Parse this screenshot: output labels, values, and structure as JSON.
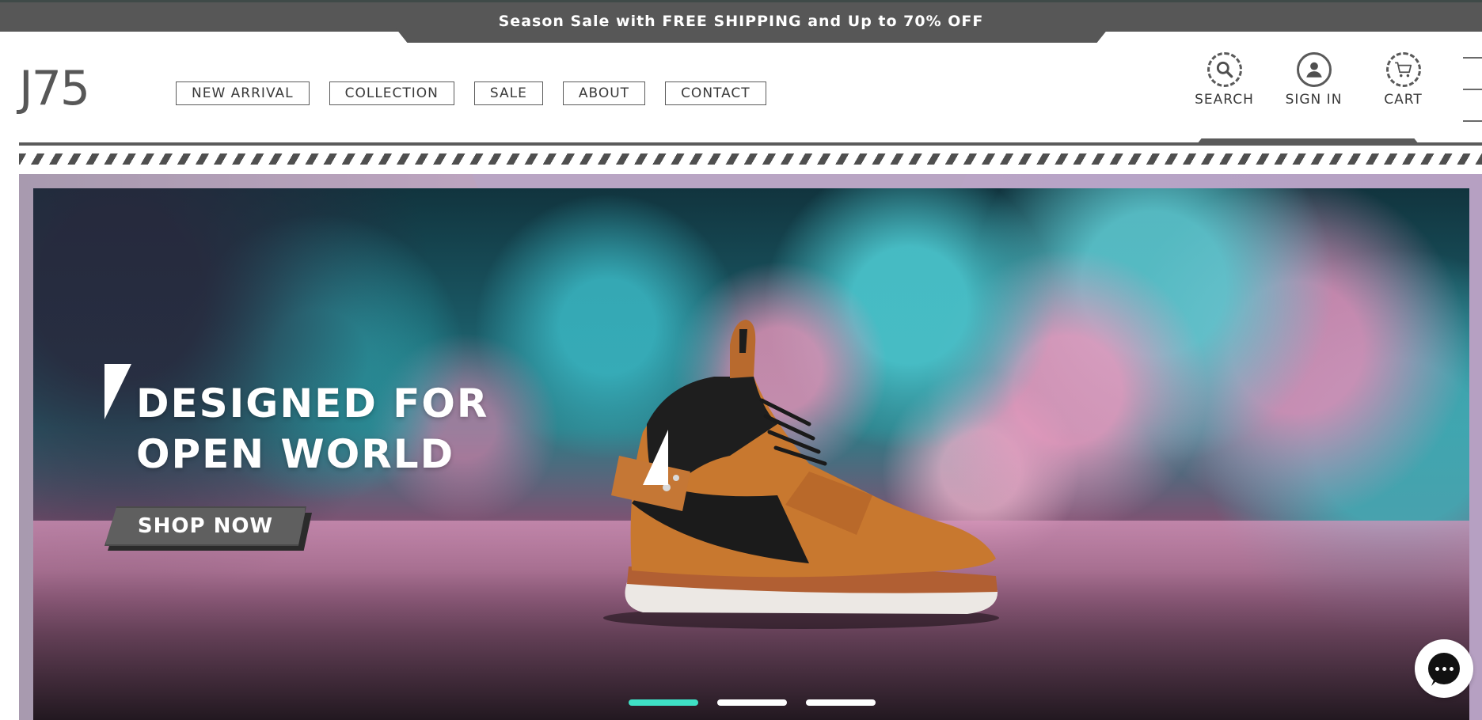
{
  "announcement": {
    "text": "Season Sale with FREE SHIPPING and Up to 70% OFF"
  },
  "header": {
    "logo": "J75",
    "nav": [
      {
        "label": "NEW ARRIVAL"
      },
      {
        "label": "COLLECTION"
      },
      {
        "label": "SALE"
      },
      {
        "label": "ABOUT"
      },
      {
        "label": "CONTACT"
      }
    ],
    "actions": {
      "search": {
        "label": "SEARCH",
        "icon": "search-icon"
      },
      "signin": {
        "label": "SIGN IN",
        "icon": "user-icon"
      },
      "cart": {
        "label": "CART",
        "icon": "cart-icon"
      }
    },
    "menu_icon": "hamburger-icon"
  },
  "hero": {
    "title_line1": "DESIGNED FOR",
    "title_line2": "OPEN WORLD",
    "cta_label": "SHOP NOW",
    "slides": 3,
    "active_slide": 1
  },
  "colors": {
    "accent": "#3fe0c5",
    "header_gray": "#575757",
    "text_dark": "#3a3a3a",
    "white": "#ffffff"
  },
  "chat": {
    "icon": "chat-icon"
  }
}
